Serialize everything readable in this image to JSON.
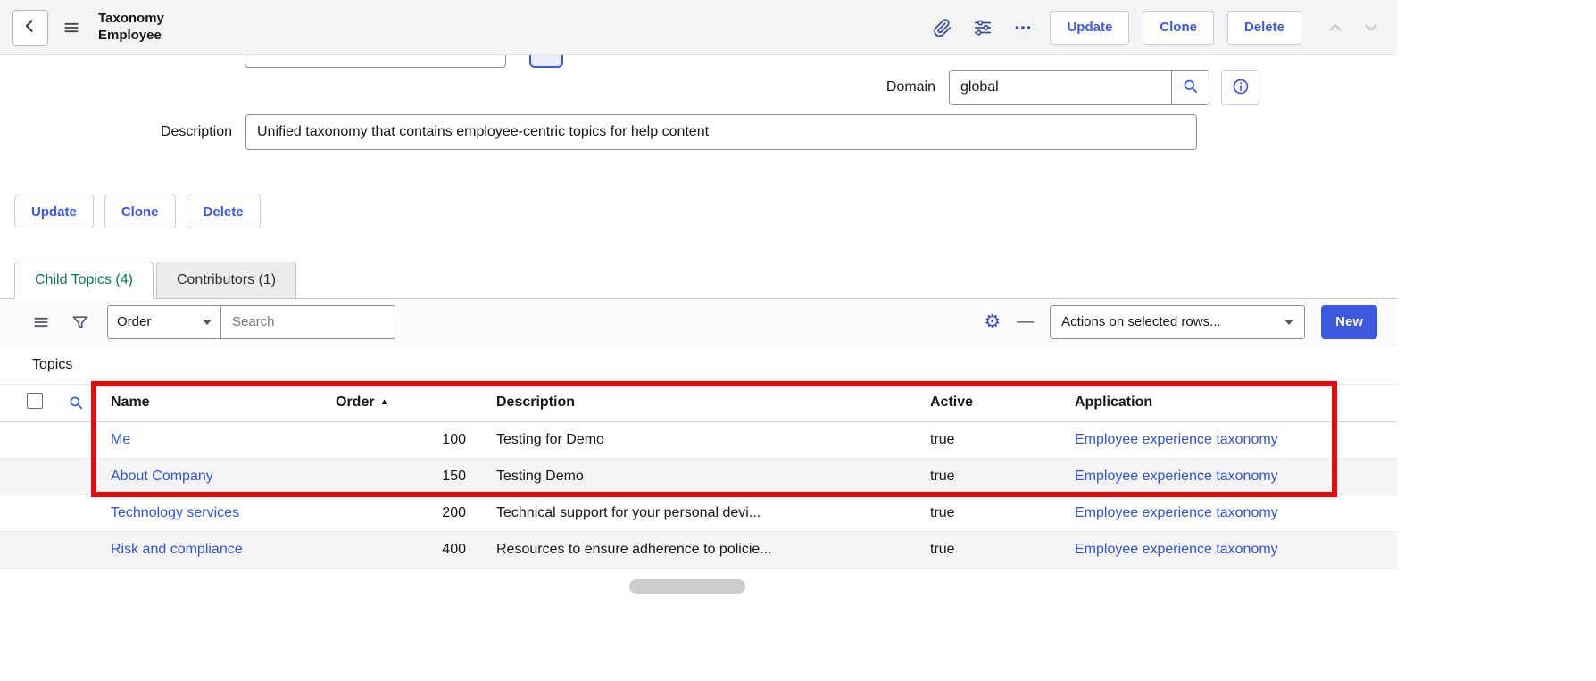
{
  "header": {
    "title_line1": "Taxonomy",
    "title_line2": "Employee",
    "buttons": [
      "Update",
      "Clone",
      "Delete"
    ]
  },
  "form": {
    "domain_label": "Domain",
    "domain_value": "global",
    "description_label": "Description",
    "description_value": "Unified taxonomy that contains employee-centric topics for help content",
    "buttons": [
      "Update",
      "Clone",
      "Delete"
    ]
  },
  "tabs": [
    {
      "label": "Child Topics (4)",
      "active": true
    },
    {
      "label": "Contributors (1)",
      "active": false
    }
  ],
  "list": {
    "toolbar": {
      "sort_field": "Order",
      "search_placeholder": "Search",
      "actions_placeholder": "Actions on selected rows...",
      "new_label": "New"
    },
    "caption": "Topics",
    "table": {
      "columns": [
        "Name",
        "Order",
        "Description",
        "Active",
        "Application"
      ],
      "sort": {
        "column": "Order",
        "direction": "asc"
      },
      "rows": [
        {
          "name": "Me",
          "order": "100",
          "description": "Testing for Demo",
          "active": "true",
          "application": "Employee experience taxonomy"
        },
        {
          "name": "About Company",
          "order": "150",
          "description": "Testing Demo",
          "active": "true",
          "application": "Employee experience taxonomy"
        },
        {
          "name": "Technology services",
          "order": "200",
          "description": "Technical support for your personal devi...",
          "active": "true",
          "application": "Employee experience taxonomy"
        },
        {
          "name": "Risk and compliance",
          "order": "400",
          "description": "Resources to ensure adherence to policie...",
          "active": "true",
          "application": "Employee experience taxonomy"
        }
      ]
    }
  },
  "icons": {
    "gear": "⚙",
    "minus": "—",
    "sort_asc": "▲"
  },
  "colors": {
    "accent": "#3d59e0",
    "link": "#2f54d0",
    "tab_active": "#0b7a4b",
    "annotation": "#e30b0b",
    "new_button": "#3d59e0"
  }
}
